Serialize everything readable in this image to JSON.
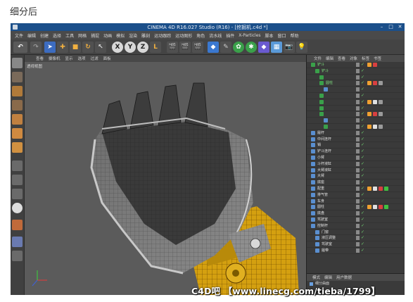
{
  "caption": "细分后",
  "window": {
    "title": "CINEMA 4D R16.027 Studio (R16) - [挖掘机.c4d *]"
  },
  "menubar": [
    "文件",
    "编辑",
    "创建",
    "选择",
    "工具",
    "网格",
    "捕捉",
    "动画",
    "模拟",
    "渲染",
    "雕刻",
    "运动跟踪",
    "运动图形",
    "角色",
    "流水线",
    "插件",
    "X-Particles",
    "脚本",
    "窗口",
    "帮助"
  ],
  "viewport": {
    "menu": [
      "查看",
      "摄像机",
      "显示",
      "选项",
      "过滤",
      "面板"
    ],
    "label": "透视视图"
  },
  "object_manager": {
    "menu": [
      "文件",
      "编辑",
      "查看",
      "对象",
      "标签",
      "书签"
    ],
    "rows": [
      {
        "label": "铲斗",
        "indent": 0,
        "green": true,
        "tags": [
          "#f0a030",
          "#d84040"
        ]
      },
      {
        "label": "铲斗",
        "indent": 1,
        "green": true,
        "tags": []
      },
      {
        "label": "",
        "indent": 2,
        "green": true,
        "tags": []
      },
      {
        "label": "圆柱",
        "indent": 2,
        "green": true,
        "tags": [
          "#f0a030",
          "#d84040",
          "#9a9a9a"
        ]
      },
      {
        "label": "",
        "indent": 3,
        "green": false,
        "tags": []
      },
      {
        "label": "",
        "indent": 2,
        "green": true,
        "tags": []
      },
      {
        "label": "",
        "indent": 2,
        "green": true,
        "tags": [
          "#f0a030",
          "#e0e0e0",
          "#9a9a9a"
        ]
      },
      {
        "label": "",
        "indent": 2,
        "green": true,
        "tags": []
      },
      {
        "label": "",
        "indent": 2,
        "green": true,
        "tags": [
          "#f0a030",
          "#d84040",
          "#9a9a9a"
        ]
      },
      {
        "label": "",
        "indent": 3,
        "green": false,
        "tags": []
      },
      {
        "label": "",
        "indent": 3,
        "green": true,
        "tags": [
          "#f0a030",
          "#e0e0e0",
          "#9a9a9a"
        ]
      },
      {
        "label": "履杆",
        "indent": 0,
        "green": false,
        "tags": []
      },
      {
        "label": "中间连杆",
        "indent": 0,
        "green": false,
        "tags": []
      },
      {
        "label": "销",
        "indent": 0,
        "green": false,
        "tags": []
      },
      {
        "label": "铲斗连杆",
        "indent": 0,
        "green": false,
        "tags": []
      },
      {
        "label": "小臂",
        "indent": 0,
        "green": false,
        "tags": []
      },
      {
        "label": "斗杆液缸",
        "indent": 0,
        "green": false,
        "tags": []
      },
      {
        "label": "大臂液缸",
        "indent": 0,
        "green": false,
        "tags": []
      },
      {
        "label": "大臂",
        "indent": 0,
        "green": false,
        "tags": []
      },
      {
        "label": "底座",
        "indent": 0,
        "green": false,
        "tags": []
      },
      {
        "label": "配重",
        "indent": 0,
        "green": false,
        "tags": [
          "#f0a030",
          "#e0e0e0",
          "#d84040",
          "#40c040"
        ]
      },
      {
        "label": "排气管",
        "indent": 0,
        "green": false,
        "tags": []
      },
      {
        "label": "车身",
        "indent": 0,
        "green": false,
        "tags": []
      },
      {
        "label": "圆柱",
        "indent": 0,
        "green": false,
        "tags": [
          "#f0a030",
          "#e0e0e0",
          "#d84040",
          "#40c040"
        ]
      },
      {
        "label": "底盘",
        "indent": 0,
        "green": false,
        "tags": []
      },
      {
        "label": "驾驶室",
        "indent": 0,
        "green": false,
        "tags": []
      },
      {
        "label": "控制杆",
        "indent": 0,
        "green": false,
        "tags": []
      },
      {
        "label": "门窗",
        "indent": 1,
        "green": false,
        "tags": []
      },
      {
        "label": "液压调整",
        "indent": 1,
        "green": false,
        "tags": []
      },
      {
        "label": "驾驶室",
        "indent": 1,
        "green": false,
        "tags": []
      },
      {
        "label": "履带",
        "indent": 1,
        "green": false,
        "tags": []
      }
    ]
  },
  "attribute_manager": {
    "menu": [
      "模式",
      "编辑",
      "用户数据"
    ],
    "row_label": "细分曲面"
  },
  "watermark": "C4D吧 【www.linecg.com/tieba/1799】"
}
